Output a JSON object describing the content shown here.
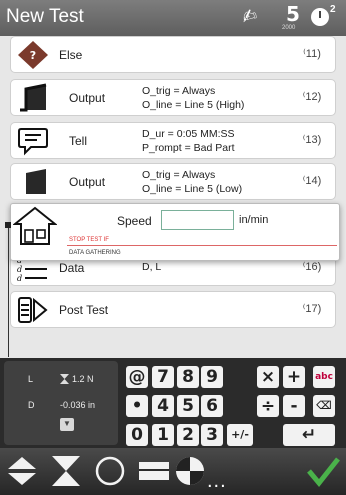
{
  "title": "New Test",
  "titlebar": {
    "five_label": "5",
    "five_sub": "2000",
    "clock_sup": "2"
  },
  "steps": [
    {
      "name": "Else",
      "p1": "",
      "p2": "",
      "num": "11)"
    },
    {
      "name": "Output",
      "p1": "O_trig = Always",
      "p2": "O_line = Line 5 (High)",
      "num": "12)"
    },
    {
      "name": "Tell",
      "p1": "D_ur = 0:05 MM:SS",
      "p2": "P_rompt = Bad Part",
      "num": "13)"
    },
    {
      "name": "Output",
      "p1": "O_trig = Always",
      "p2": "O_line = Line 5 (Low)",
      "num": "14)"
    },
    {
      "name": "Data",
      "p1": "D, L",
      "p2": "",
      "num": "16)"
    },
    {
      "name": "Post Test",
      "p1": "",
      "p2": "",
      "num": "17)"
    }
  ],
  "overlay": {
    "label": "Speed",
    "input_value": "",
    "unit": "in/min",
    "stop_test": "STOP TEST IF",
    "data_gathering": "DATA GATHERING"
  },
  "readout": {
    "l_label": "L",
    "l_value": "1.2 N",
    "d_label": "D",
    "d_value": "-0.036 in"
  },
  "keypad": {
    "row1": [
      "@",
      "7",
      "8",
      "9",
      "×",
      "+",
      "abc"
    ],
    "row2": [
      "•",
      "4",
      "5",
      "6",
      "÷",
      "-",
      "⌫"
    ],
    "row3": [
      "0",
      "1",
      "2",
      "3",
      "+/-",
      "↵"
    ]
  },
  "toolbar": {
    "more": "..."
  },
  "colors": {
    "accent_green": "#4ab24a",
    "dark": "#2b2b2b"
  }
}
